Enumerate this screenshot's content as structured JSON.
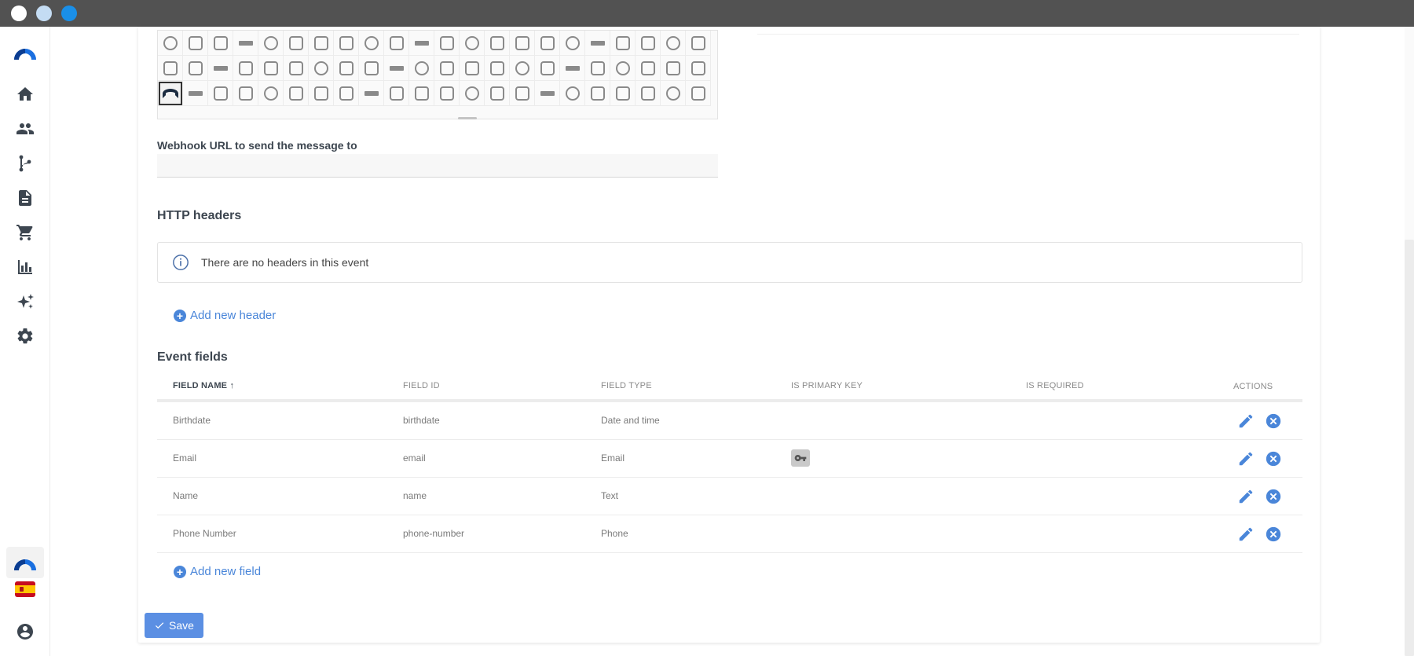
{
  "webhook": {
    "label": "Webhook URL to send the message to",
    "value": ""
  },
  "headers": {
    "title": "HTTP headers",
    "empty_message": "There are no headers in this event",
    "add_label": "Add new header"
  },
  "event_fields": {
    "title": "Event fields",
    "columns": {
      "field_name": "FIELD NAME",
      "field_id": "FIELD ID",
      "field_type": "FIELD TYPE",
      "is_primary_key": "IS PRIMARY KEY",
      "is_required": "IS REQUIRED",
      "actions": "ACTIONS"
    },
    "rows": [
      {
        "name": "Birthdate",
        "id": "birthdate",
        "type": "Date and time"
      },
      {
        "name": "Email",
        "id": "email",
        "type": "Email"
      },
      {
        "name": "Name",
        "id": "name",
        "type": "Text"
      },
      {
        "name": "Phone Number",
        "id": "phone-number",
        "type": "Phone"
      }
    ],
    "add_label": "Add new field"
  },
  "save_label": "Save",
  "accent_color": "#4a86d9"
}
